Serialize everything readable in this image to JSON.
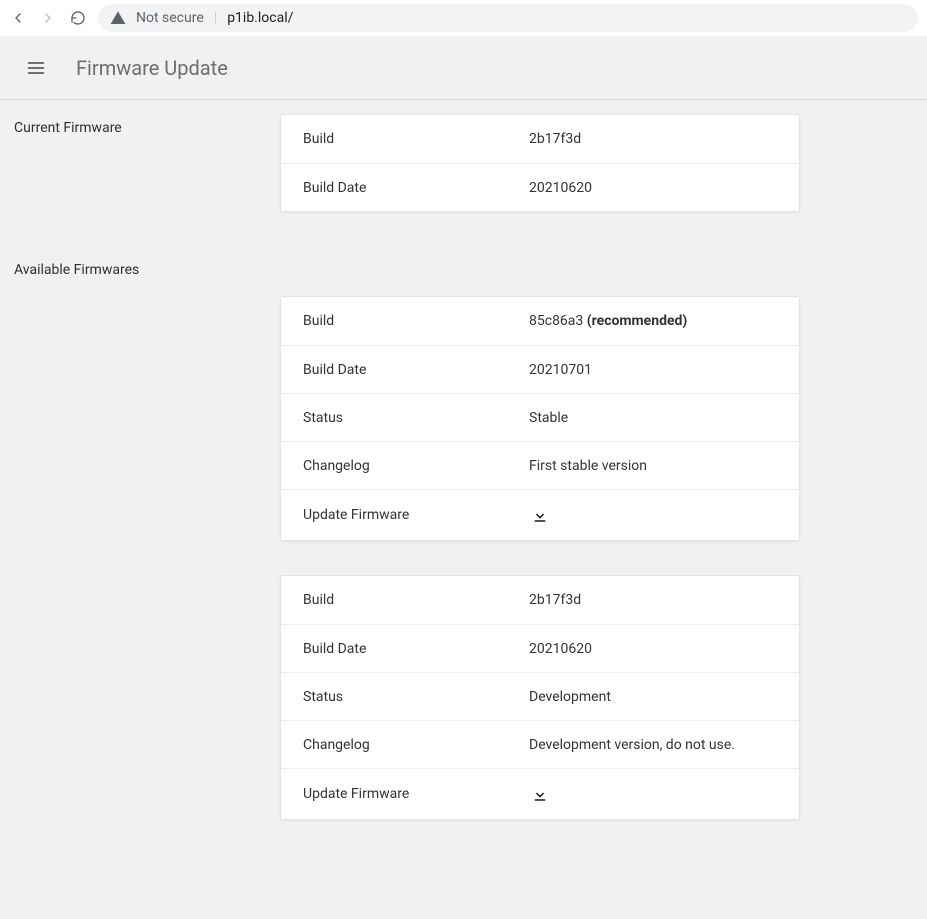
{
  "browser": {
    "security_label": "Not secure",
    "url": "p1ib.local/"
  },
  "header": {
    "title": "Firmware Update"
  },
  "labels": {
    "build": "Build",
    "build_date": "Build Date",
    "status": "Status",
    "changelog": "Changelog",
    "update_firmware": "Update Firmware",
    "current_firmware": "Current Firmware",
    "available_firmwares": "Available Firmwares",
    "recommended_suffix": "(recommended)"
  },
  "current": {
    "build": "2b17f3d",
    "build_date": "20210620"
  },
  "available": [
    {
      "build": "85c86a3",
      "recommended": true,
      "build_date": "20210701",
      "status": "Stable",
      "changelog": "First stable version"
    },
    {
      "build": "2b17f3d",
      "recommended": false,
      "build_date": "20210620",
      "status": "Development",
      "changelog": "Development version, do not use."
    }
  ]
}
